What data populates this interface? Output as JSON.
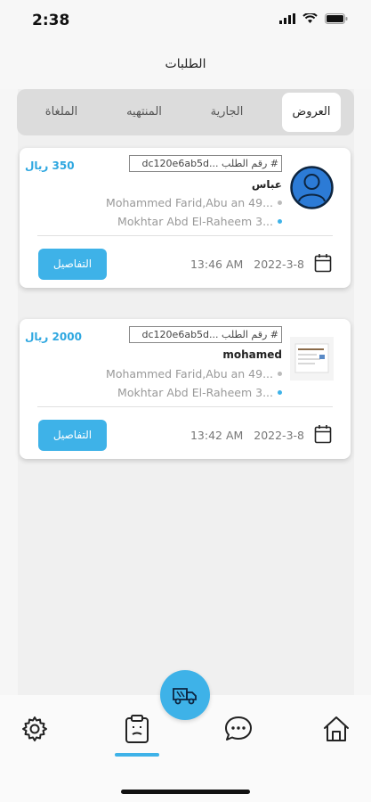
{
  "status_bar": {
    "time": "2:38"
  },
  "header": {
    "title": "الطلبات"
  },
  "tabs": [
    {
      "label": "العروض",
      "active": true
    },
    {
      "label": "الجارية",
      "active": false
    },
    {
      "label": "المنتهيه",
      "active": false
    },
    {
      "label": "الملغاة",
      "active": false
    }
  ],
  "orders": [
    {
      "price": "350 ريال",
      "order_number": "# رقم الطلب ...dc120e6ab5d",
      "customer_name": "عباس",
      "from": "Mohammed Farid,Abu an 49...",
      "to": "Mokhtar Abd El-Raheem 3...",
      "date": "2022-3-8",
      "time": "13:46 AM",
      "details_label": "التفاصيل",
      "avatar": "default-user-avatar"
    },
    {
      "price": "2000 ريال",
      "order_number": "# رقم الطلب ...dc120e6ab5d",
      "customer_name": "mohamed",
      "from": "Mohammed Farid,Abu an 49...",
      "to": "Mokhtar Abd El-Raheem 3...",
      "date": "2022-3-8",
      "time": "13:42 AM",
      "details_label": "التفاصيل",
      "avatar": "document-thumbnail"
    }
  ],
  "tab_bar": {
    "items": [
      {
        "icon": "gear-icon"
      },
      {
        "icon": "clipboard-icon",
        "active": true
      },
      {
        "icon": "chat-icon"
      },
      {
        "icon": "home-icon"
      }
    ],
    "fab_icon": "truck-icon"
  },
  "colors": {
    "accent": "#3eb2e8",
    "price": "#2ea7e0",
    "from_dot": "#bbbbbb",
    "to_dot": "#3eb2e8"
  }
}
